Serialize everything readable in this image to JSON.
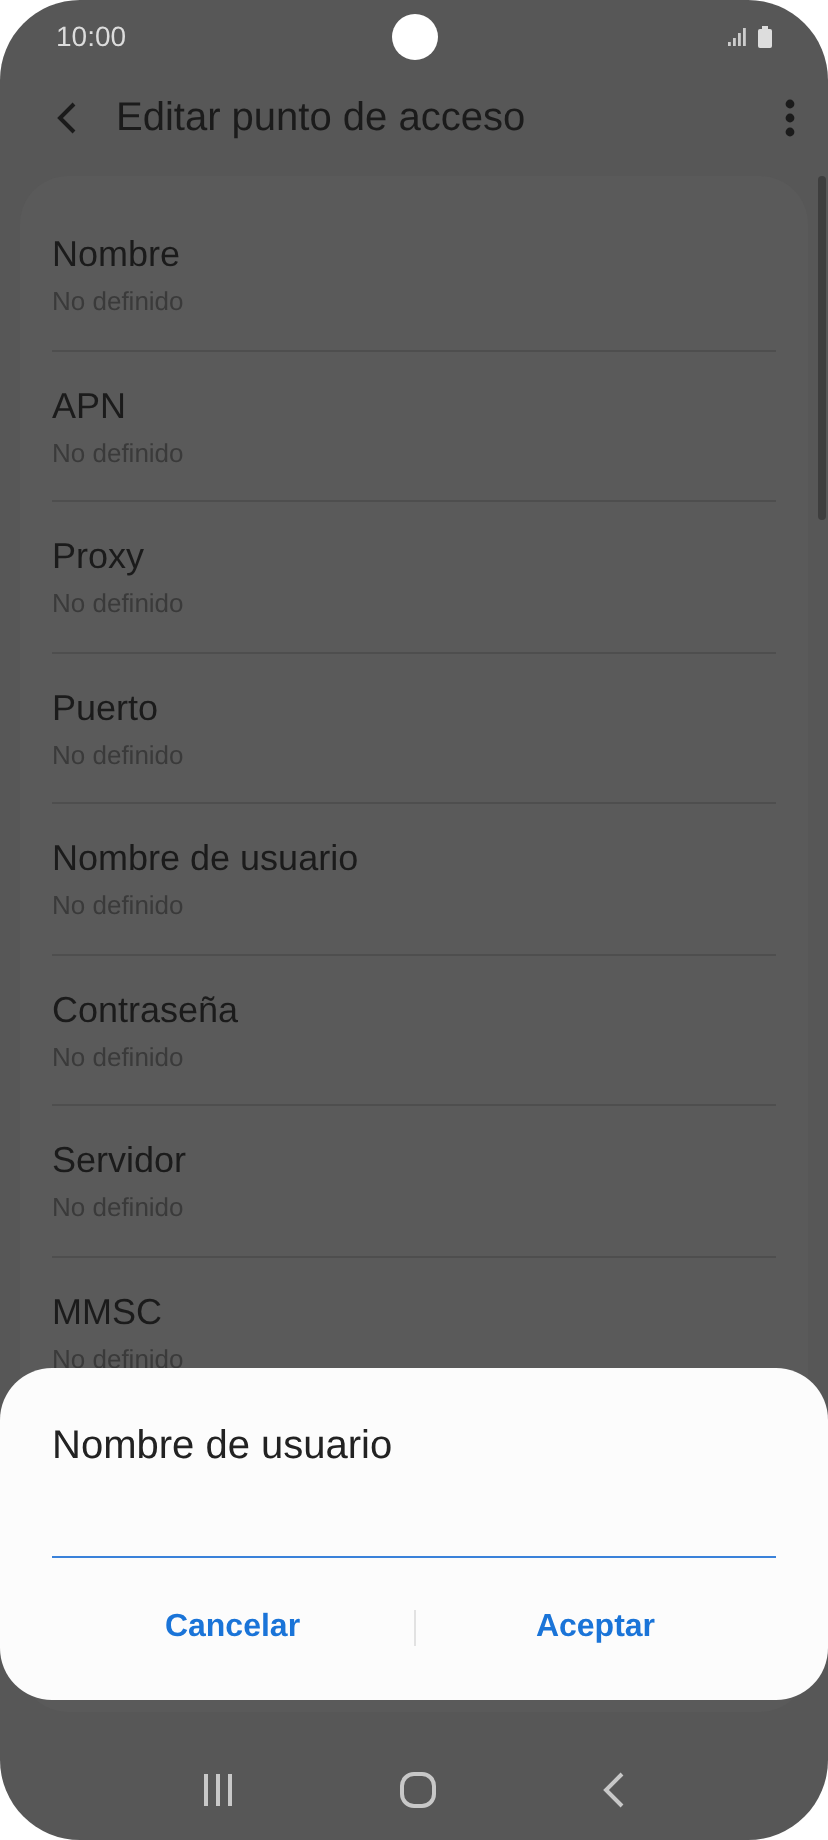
{
  "status_bar": {
    "time": "10:00"
  },
  "app_bar": {
    "title": "Editar punto de acceso"
  },
  "settings": [
    {
      "title": "Nombre",
      "value": "No definido"
    },
    {
      "title": "APN",
      "value": "No definido"
    },
    {
      "title": "Proxy",
      "value": "No definido"
    },
    {
      "title": "Puerto",
      "value": "No definido"
    },
    {
      "title": "Nombre de usuario",
      "value": "No definido"
    },
    {
      "title": "Contraseña",
      "value": "No definido"
    },
    {
      "title": "Servidor",
      "value": "No definido"
    },
    {
      "title": "MMSC",
      "value": "No definido"
    }
  ],
  "dialog": {
    "title": "Nombre de usuario",
    "buttons": [
      "Cancelar",
      "Aceptar"
    ]
  }
}
